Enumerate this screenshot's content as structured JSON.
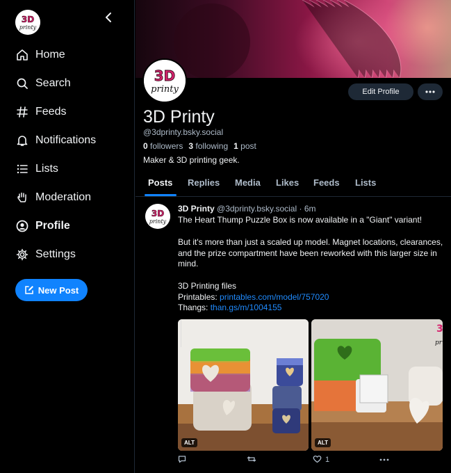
{
  "sidebar": {
    "nav": [
      {
        "label": "Home",
        "icon": "home-icon"
      },
      {
        "label": "Search",
        "icon": "search-icon"
      },
      {
        "label": "Feeds",
        "icon": "hash-icon"
      },
      {
        "label": "Notifications",
        "icon": "bell-icon"
      },
      {
        "label": "Lists",
        "icon": "list-icon"
      },
      {
        "label": "Moderation",
        "icon": "hand-icon"
      },
      {
        "label": "Profile",
        "icon": "user-icon",
        "active": true
      },
      {
        "label": "Settings",
        "icon": "gear-icon"
      }
    ],
    "new_post_label": "New Post"
  },
  "profile": {
    "display_name": "3D Printy",
    "handle": "@3dprinty.bsky.social",
    "followers_count": "0",
    "followers_label": "followers",
    "following_count": "3",
    "following_label": "following",
    "posts_count": "1",
    "posts_label": "post",
    "bio": "Maker & 3D printing geek.",
    "edit_profile_label": "Edit Profile",
    "avatar_text_top": "3D",
    "avatar_text_bottom": "printy"
  },
  "tabs": [
    "Posts",
    "Replies",
    "Media",
    "Likes",
    "Feeds",
    "Lists"
  ],
  "post": {
    "author": "3D Printy",
    "handle": "@3dprinty.bsky.social",
    "time": "· 6m",
    "line1": "The Heart Thump Puzzle Box is now available in a \"Giant\" variant!",
    "para2": "But it's more than just a scaled up model. Magnet locations, clearances, and the prize compartment have been reworked with this larger size in mind.",
    "files_heading": "3D Printing files",
    "printables_label": "Printables: ",
    "printables_link": "printables.com/model/757020",
    "thangs_label": "Thangs: ",
    "thangs_link": "than.gs/m/1004155",
    "alt_badge": "ALT",
    "like_count": "1"
  },
  "colors": {
    "accent": "#1083fe",
    "link": "#208bfe",
    "background": "#000000",
    "muted_text": "#aebbc9",
    "button_bg": "#1e2936"
  }
}
